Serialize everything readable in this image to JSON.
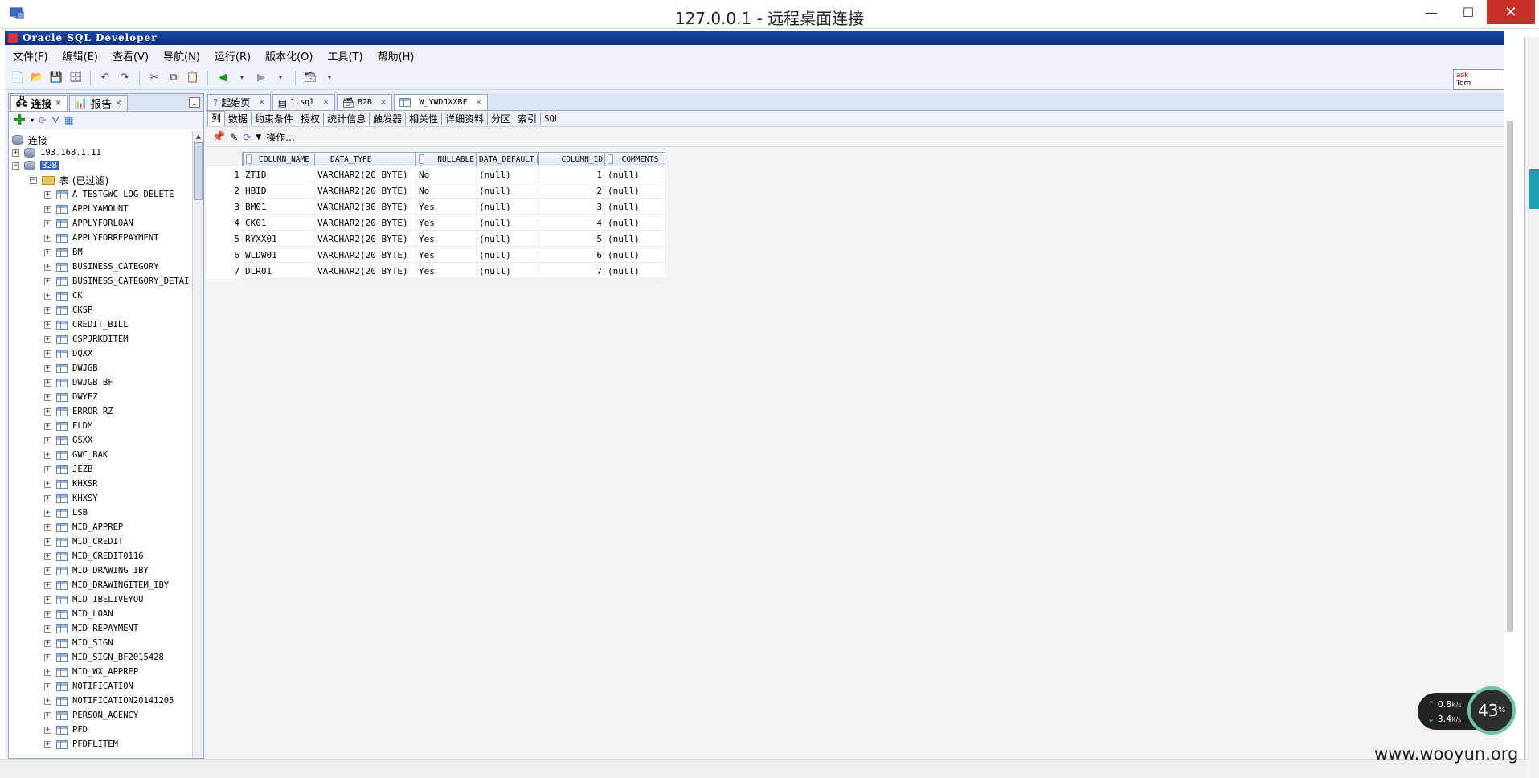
{
  "window": {
    "rdp_title": "127.0.0.1 - 远程桌面连接",
    "min_label": "—",
    "max_label": "☐",
    "close_label": "✕"
  },
  "app": {
    "title": "Oracle SQL Developer"
  },
  "menu": [
    "文件(F)",
    "编辑(E)",
    "查看(V)",
    "导航(N)",
    "运行(R)",
    "版本化(O)",
    "工具(T)",
    "帮助(H)"
  ],
  "asktom": {
    "line1": "ask",
    "line2": "Tom"
  },
  "left_panel": {
    "tabs": [
      {
        "label": "连接",
        "active": true
      },
      {
        "label": "报告",
        "active": false
      }
    ],
    "tree": {
      "root": "连接",
      "servers": [
        "193.168.1.11"
      ],
      "connection": "B2B",
      "tables_folder": "表 (已过滤)",
      "tables": [
        "A_TESTGWC_LOG_DELETE",
        "APPLYAMOUNT",
        "APPLYFORLOAN",
        "APPLYFORREPAYMENT",
        "BM",
        "BUSINESS_CATEGORY",
        "BUSINESS_CATEGORY_DETAI",
        "CK",
        "CKSP",
        "CREDIT_BILL",
        "CSPJRKDITEM",
        "DQXX",
        "DWJGB",
        "DWJGB_BF",
        "DWYEZ",
        "ERROR_RZ",
        "FLDM",
        "GSXX",
        "GWC_BAK",
        "JEZB",
        "KHXSR",
        "KHXSY",
        "LSB",
        "MID_APPREP",
        "MID_CREDIT",
        "MID_CREDIT0116",
        "MID_DRAWING_IBY",
        "MID_DRAWINGITEM_IBY",
        "MID_IBELIVEYOU",
        "MID_LOAN",
        "MID_REPAYMENT",
        "MID_SIGN",
        "MID_SIGN_BF2015428",
        "MID_WX_APPREP",
        "NOTIFICATION",
        "NOTIFICATION20141205",
        "PERSON_AGENCY",
        "PFD",
        "PFDFLITEM"
      ]
    }
  },
  "doc_tabs": [
    {
      "label": "起始页",
      "active": false
    },
    {
      "label": "1.sql",
      "active": false
    },
    {
      "label": "B2B",
      "active": false
    },
    {
      "label": "W_YWDJXXBF",
      "active": true
    }
  ],
  "sub_tabs": [
    "列",
    "数据",
    "约束条件",
    "授权",
    "统计信息",
    "触发器",
    "相关性",
    "详细资料",
    "分区",
    "索引",
    "SQL"
  ],
  "actions_label": "操作...",
  "grid": {
    "columns": [
      "COLUMN_NAME",
      "DATA_TYPE",
      "NULLABLE",
      "DATA_DEFAULT",
      "COLUMN_ID",
      "COMMENTS"
    ],
    "rows": [
      {
        "n": "1",
        "name": "ZTID",
        "type": "VARCHAR2(20 BYTE)",
        "nullable": "No",
        "default": "(null)",
        "id": "1",
        "comments": "(null)"
      },
      {
        "n": "2",
        "name": "HBID",
        "type": "VARCHAR2(20 BYTE)",
        "nullable": "No",
        "default": "(null)",
        "id": "2",
        "comments": "(null)"
      },
      {
        "n": "3",
        "name": "BM01",
        "type": "VARCHAR2(30 BYTE)",
        "nullable": "Yes",
        "default": "(null)",
        "id": "3",
        "comments": "(null)"
      },
      {
        "n": "4",
        "name": "CK01",
        "type": "VARCHAR2(20 BYTE)",
        "nullable": "Yes",
        "default": "(null)",
        "id": "4",
        "comments": "(null)"
      },
      {
        "n": "5",
        "name": "RYXX01",
        "type": "VARCHAR2(20 BYTE)",
        "nullable": "Yes",
        "default": "(null)",
        "id": "5",
        "comments": "(null)"
      },
      {
        "n": "6",
        "name": "WLDW01",
        "type": "VARCHAR2(20 BYTE)",
        "nullable": "Yes",
        "default": "(null)",
        "id": "6",
        "comments": "(null)"
      },
      {
        "n": "7",
        "name": "DLR01",
        "type": "VARCHAR2(20 BYTE)",
        "nullable": "Yes",
        "default": "(null)",
        "id": "7",
        "comments": "(null)"
      }
    ]
  },
  "net_widget": {
    "up": "0.8",
    "up_unit": "K/s",
    "down": "3.4",
    "down_unit": "K/s",
    "cpu": "43",
    "cpu_unit": "%"
  },
  "watermark": "www.wooyun.org",
  "colors": {
    "selection": "#2f62c4",
    "title_bar": "#0b2f7e",
    "close_button": "#c7312a"
  }
}
